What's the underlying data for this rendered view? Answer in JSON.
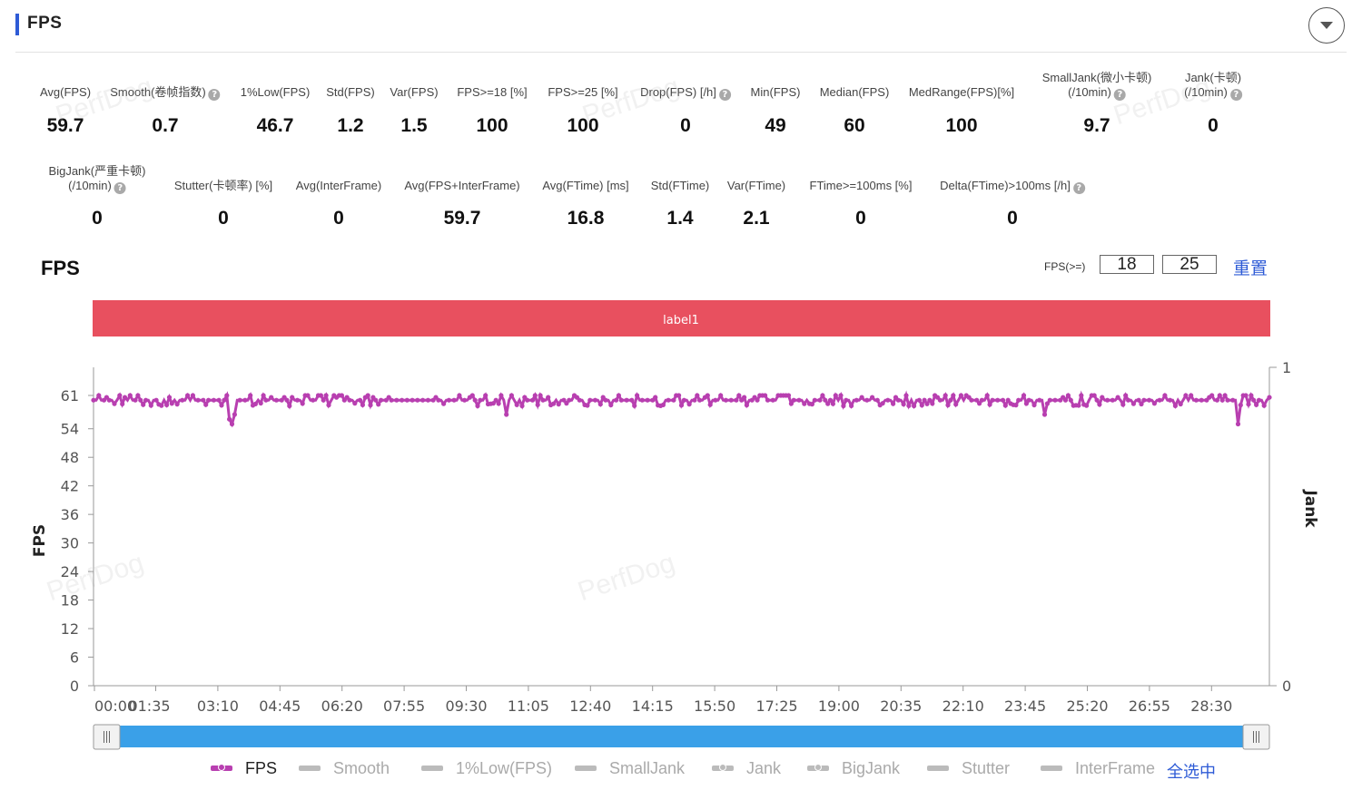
{
  "header": {
    "title": "FPS"
  },
  "metrics_row1": [
    {
      "label": "Avg(FPS)",
      "value": "59.7",
      "help": false
    },
    {
      "label": "Smooth(卷帧指数)",
      "value": "0.7",
      "help": true
    },
    {
      "label": "1%Low(FPS)",
      "value": "46.7",
      "help": false
    },
    {
      "label": "Std(FPS)",
      "value": "1.2",
      "help": false
    },
    {
      "label": "Var(FPS)",
      "value": "1.5",
      "help": false
    },
    {
      "label": "FPS>=18 [%]",
      "value": "100",
      "help": false
    },
    {
      "label": "FPS>=25 [%]",
      "value": "100",
      "help": false
    },
    {
      "label": "Drop(FPS) [/h]",
      "value": "0",
      "help": true
    },
    {
      "label": "Min(FPS)",
      "value": "49",
      "help": false
    },
    {
      "label": "Median(FPS)",
      "value": "60",
      "help": false
    },
    {
      "label": "MedRange(FPS)[%]",
      "value": "100",
      "help": false
    },
    {
      "label": "SmallJank(微小卡顿)",
      "label2": "(/10min)",
      "value": "9.7",
      "help": true
    },
    {
      "label": "Jank(卡顿)",
      "label2": "(/10min)",
      "value": "0",
      "help": true
    }
  ],
  "metrics_row2": [
    {
      "label": "BigJank(严重卡顿)",
      "label2": "(/10min)",
      "value": "0",
      "help": true
    },
    {
      "label": "Stutter(卡顿率) [%]",
      "value": "0",
      "help": false
    },
    {
      "label": "Avg(InterFrame)",
      "value": "0",
      "help": false
    },
    {
      "label": "Avg(FPS+InterFrame)",
      "value": "59.7",
      "help": false
    },
    {
      "label": "Avg(FTime) [ms]",
      "value": "16.8",
      "help": false
    },
    {
      "label": "Std(FTime)",
      "value": "1.4",
      "help": false
    },
    {
      "label": "Var(FTime)",
      "value": "2.1",
      "help": false
    },
    {
      "label": "FTime>=100ms [%]",
      "value": "0",
      "help": false
    },
    {
      "label": "Delta(FTime)>100ms [/h]",
      "value": "0",
      "help": true
    }
  ],
  "chart_panel": {
    "title": "FPS",
    "threshold_label": "FPS(>=)",
    "threshold_low": "18",
    "threshold_high": "25",
    "reset_label": "重置",
    "label_bar": "label1",
    "select_all": "全选中"
  },
  "legend": [
    {
      "name": "FPS",
      "color": "#b83fb0",
      "active": true,
      "marker": "dot"
    },
    {
      "name": "Smooth",
      "color": "#bbbbbb",
      "active": false,
      "marker": "line"
    },
    {
      "name": "1%Low(FPS)",
      "color": "#bbbbbb",
      "active": false,
      "marker": "line"
    },
    {
      "name": "SmallJank",
      "color": "#bbbbbb",
      "active": false,
      "marker": "line"
    },
    {
      "name": "Jank",
      "color": "#bbbbbb",
      "active": false,
      "marker": "dot"
    },
    {
      "name": "BigJank",
      "color": "#bbbbbb",
      "active": false,
      "marker": "dot"
    },
    {
      "name": "Stutter",
      "color": "#bbbbbb",
      "active": false,
      "marker": "line"
    },
    {
      "name": "InterFrame",
      "color": "#bbbbbb",
      "active": false,
      "marker": "line"
    }
  ],
  "watermark": "PerfDog",
  "colors": {
    "accent": "#2e5bd6",
    "fps_series": "#b83fb0",
    "label_bar": "#e8505f",
    "slider": "#3aa0e8"
  },
  "chart_data": {
    "type": "line",
    "ylabel": "FPS",
    "y2label": "Jank",
    "yticks": [
      0,
      6,
      12,
      18,
      24,
      30,
      36,
      42,
      48,
      54,
      61
    ],
    "ylim": [
      0,
      61
    ],
    "y2ticks": [
      0,
      1
    ],
    "xticks": [
      "00:00",
      "01:35",
      "03:10",
      "04:45",
      "06:20",
      "07:55",
      "09:30",
      "11:05",
      "12:40",
      "14:15",
      "15:50",
      "17:25",
      "19:00",
      "20:35",
      "22:10",
      "23:45",
      "25:20",
      "26:55",
      "28:30"
    ],
    "x_range_seconds": [
      0,
      1800
    ],
    "series": [
      {
        "name": "FPS",
        "baseline": 60,
        "dips": [
          {
            "t": 208,
            "v": 56
          },
          {
            "t": 213,
            "v": 55
          },
          {
            "t": 218,
            "v": 57
          },
          {
            "t": 632,
            "v": 57
          },
          {
            "t": 1456,
            "v": 57
          },
          {
            "t": 1751,
            "v": 56
          },
          {
            "t": 1754,
            "v": 55
          }
        ],
        "notes_range": [
          58,
          61
        ]
      }
    ],
    "grid": false
  }
}
